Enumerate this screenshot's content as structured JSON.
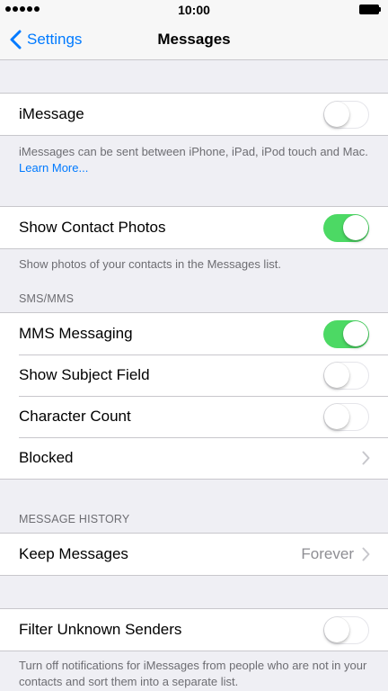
{
  "status_bar": {
    "time": "10:00",
    "signal_dots": 5
  },
  "nav": {
    "back_label": "Settings",
    "title": "Messages"
  },
  "imessage": {
    "label": "iMessage",
    "toggle_on": false,
    "footer_text": "iMessages can be sent between iPhone, iPad, iPod touch and Mac.",
    "footer_link": "Learn More..."
  },
  "contact_photos": {
    "label": "Show Contact Photos",
    "toggle_on": true,
    "footer_text": "Show photos of your contacts in the Messages list."
  },
  "sms_mms": {
    "header": "SMS/MMS",
    "rows": [
      {
        "label": "MMS Messaging",
        "toggle_on": true
      },
      {
        "label": "Show Subject Field",
        "toggle_on": false
      },
      {
        "label": "Character Count",
        "toggle_on": false
      },
      {
        "label": "Blocked"
      }
    ]
  },
  "message_history": {
    "header": "MESSAGE HISTORY",
    "keep_label": "Keep Messages",
    "keep_value": "Forever"
  },
  "filter": {
    "label": "Filter Unknown Senders",
    "toggle_on": false,
    "footer_text": "Turn off notifications for iMessages from people who are not in your contacts and sort them into a separate list."
  },
  "colors": {
    "accent": "#007aff",
    "toggle_on": "#4cd964",
    "background": "#efeff4",
    "separator": "#c8c7cc",
    "secondary_text": "#6d6d72"
  },
  "icons": {
    "back": "chevron-left-icon",
    "disclosure": "chevron-right-icon"
  }
}
